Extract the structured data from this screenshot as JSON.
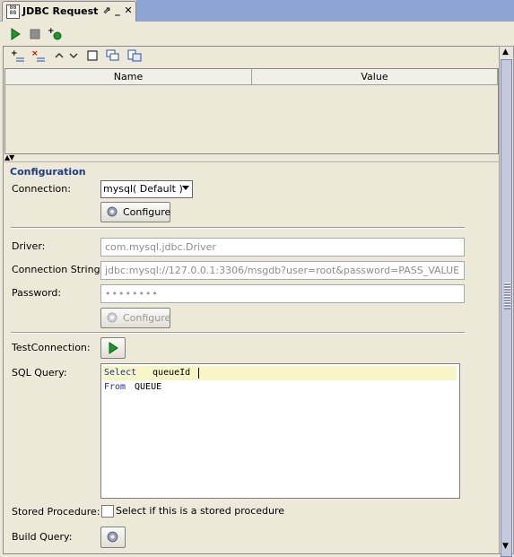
{
  "tab": {
    "title": "JDBC Request",
    "controls": [
      "pin",
      "minimize",
      "close"
    ]
  },
  "toolbar": {
    "run_icon": "play-icon",
    "stop_icon": "stop-icon",
    "add_icon": "add-run-icon"
  },
  "params": {
    "toolbar_icons": [
      "add-param-icon",
      "remove-param-icon",
      "move-up-icon",
      "move-down-icon",
      "clear-icon",
      "copy-icon",
      "paste-icon"
    ],
    "columns": [
      "Name",
      "Value"
    ],
    "rows": []
  },
  "configuration": {
    "section_title": "Configuration",
    "connection_label": "Connection:",
    "connection_value": "mysql( Default )",
    "configure_label": "Configure",
    "driver_label": "Driver:",
    "driver_value": "com.mysql.jdbc.Driver",
    "connection_string_label": "Connection String:",
    "connection_string_value": "jdbc:mysql://127.0.0.1:3306/msgdb?user=root&password=PASS_VALUE",
    "password_label": "Password:",
    "password_value": "••••••••",
    "configure_disabled_label": "Configure",
    "test_connection_label": "TestConnection:",
    "sql_query_label": "SQL Query:",
    "sql": {
      "line1_kw": "Select",
      "line1_rest": "  queueId",
      "line2_kw": "From",
      "line2_rest": " QUEUE"
    },
    "stored_procedure_label": "Stored Procedure:",
    "stored_procedure_checkbox": "Select if this is a stored procedure",
    "build_query_label": "Build Query:"
  },
  "colors": {
    "accent": "#1e3c8c",
    "run_green": "#1a9a2a",
    "highlight": "#f7f5c6"
  }
}
